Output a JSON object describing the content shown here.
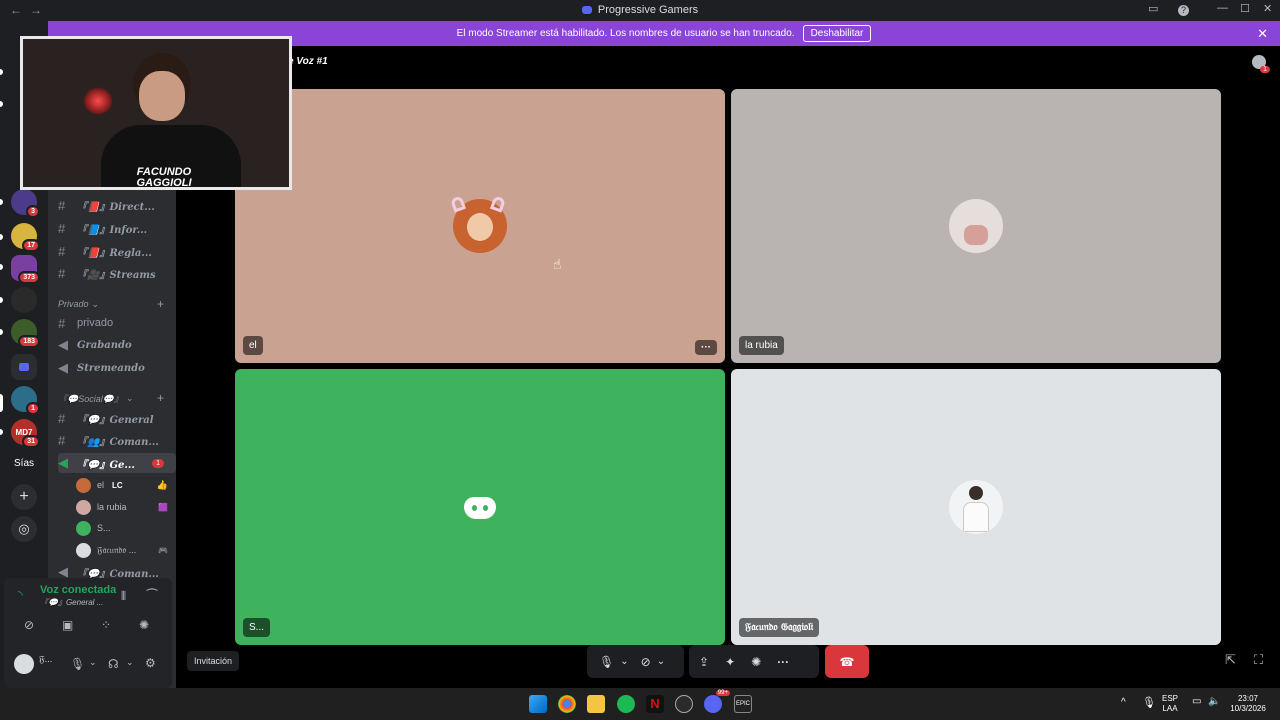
{
  "window": {
    "title": "Progressive Gamers",
    "nav_back": "←",
    "nav_forward": "→",
    "min": "—",
    "max": "☐",
    "close": "✕",
    "help": "?",
    "inbox": "▭"
  },
  "banner": {
    "text": "El modo Streamer está habilitado. Los nombres de usuario se han truncado.",
    "button": "Deshabilitar",
    "close": "✕"
  },
  "rail": {
    "badges": [
      "3",
      "17",
      "373",
      "183",
      "1",
      "31"
    ],
    "label_sias": "Sías",
    "add": "+",
    "explore": "◎",
    "server_text": "MD7"
  },
  "channels": [
    {
      "name": "『📕』Direct...",
      "type": "text"
    },
    {
      "name": "『📘』Infor...",
      "type": "text"
    },
    {
      "name": "『📕』Regla...",
      "type": "text"
    },
    {
      "name": "『🎥』Streams",
      "type": "text"
    }
  ],
  "categories": {
    "privado": "Privado",
    "social": "『💬Social💬』"
  },
  "private_channels": [
    {
      "name": "privado",
      "type": "text"
    },
    {
      "name": "Grabando",
      "type": "voice"
    },
    {
      "name": "Stremeando",
      "type": "voice"
    }
  ],
  "social_channels": [
    {
      "name": "『💬』General",
      "type": "text"
    },
    {
      "name": "『👥』Coman...",
      "type": "text"
    },
    {
      "name": "『💬』Ge...",
      "type": "voice",
      "badge": "1"
    }
  ],
  "members": [
    {
      "name": "el",
      "tag": "LC",
      "icon": "👍"
    },
    {
      "name": "la rubia",
      "tag": "",
      "icon": "🟪"
    },
    {
      "name": "S...",
      "tag": "",
      "icon": ""
    },
    {
      "name": "𝔉𝔞𝔠𝔲𝔫𝔡𝔬 ...",
      "tag": "",
      "icon": "🎮"
    }
  ],
  "next_channel": "『💬』Coman...",
  "voice_panel": {
    "status": "Voz conectada",
    "channel": "『💬』General ..."
  },
  "user": {
    "name": "𝔉...",
    "settings": "⚙"
  },
  "stage": {
    "title": "e Voz #1",
    "notif_badge": "1"
  },
  "tiles": [
    {
      "name": "el",
      "bg": "#c9a292",
      "more": "···"
    },
    {
      "name": "la rubia",
      "bg": "#b9b4b1"
    },
    {
      "name": "S...",
      "bg": "#3fb25d"
    },
    {
      "name": "𝔉𝔞𝔠𝔲𝔫𝔡𝔬 𝔊𝔞𝔤𝔤𝔦𝔬𝔩𝔦",
      "bg": "#dfe3e6"
    }
  ],
  "webcam": {
    "overlay_line1": "FACUNDO",
    "overlay_line2": "GAGGIOLI"
  },
  "invite": "Invitación",
  "controls": {
    "mic": "🎙",
    "cam": "⊘",
    "share": "⇪",
    "activities": "✦",
    "soundboard": "✺",
    "more": "···",
    "hangup": "☎",
    "chevron": "⌄"
  },
  "taskbar": {
    "lang1": "ESP",
    "lang2": "LAA",
    "time": "23:07",
    "date": "10/3/2026",
    "discord_badge": "99+"
  },
  "colors": {
    "accent": "#5865f2",
    "banner": "#8b44d8",
    "hangup": "#da373c",
    "connected": "#23a55a"
  }
}
